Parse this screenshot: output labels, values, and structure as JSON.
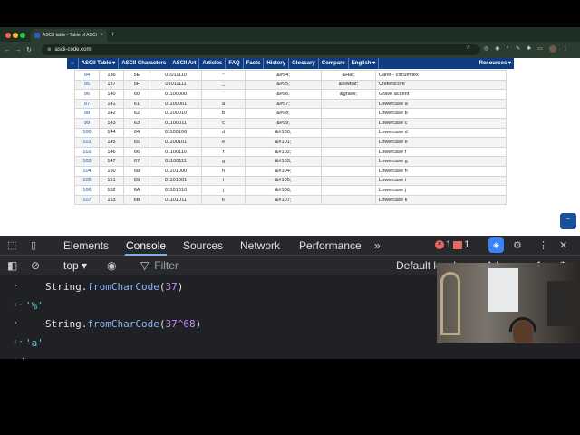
{
  "browser": {
    "tab_title": "ASCII table - Table of ASCII c",
    "tab_close": "×",
    "new_tab": "+",
    "url": "ascii-code.com"
  },
  "site_nav": {
    "items": [
      "ASCII Table ▾",
      "ASCII Characters",
      "ASCII Art",
      "Articles",
      "FAQ",
      "Facts",
      "History",
      "Glossary",
      "Compare",
      "English ▾"
    ],
    "resources": "Resources ▾"
  },
  "ascii_rows": [
    [
      "94",
      "136",
      "5E",
      "01011110",
      "^",
      "&#94;",
      "&Hat;",
      "Caret - circumflex"
    ],
    [
      "95",
      "137",
      "5F",
      "01011111",
      "_",
      "&#95;",
      "&lowbar;",
      "Underscore"
    ],
    [
      "96",
      "140",
      "60",
      "01100000",
      "`",
      "&#96;",
      "&grave;",
      "Grave accent"
    ],
    [
      "97",
      "141",
      "61",
      "01100001",
      "a",
      "&#97;",
      "",
      "Lowercase a"
    ],
    [
      "98",
      "142",
      "62",
      "01100010",
      "b",
      "&#98;",
      "",
      "Lowercase b"
    ],
    [
      "99",
      "143",
      "63",
      "01100011",
      "c",
      "&#99;",
      "",
      "Lowercase c"
    ],
    [
      "100",
      "144",
      "64",
      "01100100",
      "d",
      "&#100;",
      "",
      "Lowercase d"
    ],
    [
      "101",
      "145",
      "65",
      "01100101",
      "e",
      "&#101;",
      "",
      "Lowercase e"
    ],
    [
      "102",
      "146",
      "66",
      "01100110",
      "f",
      "&#102;",
      "",
      "Lowercase f"
    ],
    [
      "103",
      "147",
      "67",
      "01100111",
      "g",
      "&#103;",
      "",
      "Lowercase g"
    ],
    [
      "104",
      "150",
      "68",
      "01101000",
      "h",
      "&#104;",
      "",
      "Lowercase h"
    ],
    [
      "105",
      "151",
      "69",
      "01101001",
      "i",
      "&#105;",
      "",
      "Lowercase i"
    ],
    [
      "106",
      "152",
      "6A",
      "01101010",
      "j",
      "&#106;",
      "",
      "Lowercase j"
    ],
    [
      "107",
      "153",
      "6B",
      "01101011",
      "k",
      "&#107;",
      "",
      "Lowercase k"
    ]
  ],
  "devtools": {
    "tabs": [
      "Elements",
      "Console",
      "Sources",
      "Network",
      "Performance"
    ],
    "more_tabs": "»",
    "error_count": "1",
    "warning_count": "1",
    "context": "top",
    "filter_placeholder": "Filter",
    "levels": "Default levels",
    "issues": "1 Issue:",
    "issues_count": "1"
  },
  "console": {
    "lines": [
      {
        "type": "input",
        "fn": "fromCharCode",
        "obj": "String.",
        "args": "37"
      },
      {
        "type": "output",
        "value": "'%'"
      },
      {
        "type": "input",
        "fn": "fromCharCode",
        "obj": "String.",
        "args": "37^68"
      },
      {
        "type": "output",
        "value": "'a'"
      }
    ]
  },
  "colors": {
    "site_nav": "#0d3c82",
    "devtools_bg": "#202124",
    "console_fn": "#8ab4f8",
    "console_string": "#5ccfe6",
    "error_badge": "#e46962",
    "active_tab_underline": "#7cacf8"
  }
}
